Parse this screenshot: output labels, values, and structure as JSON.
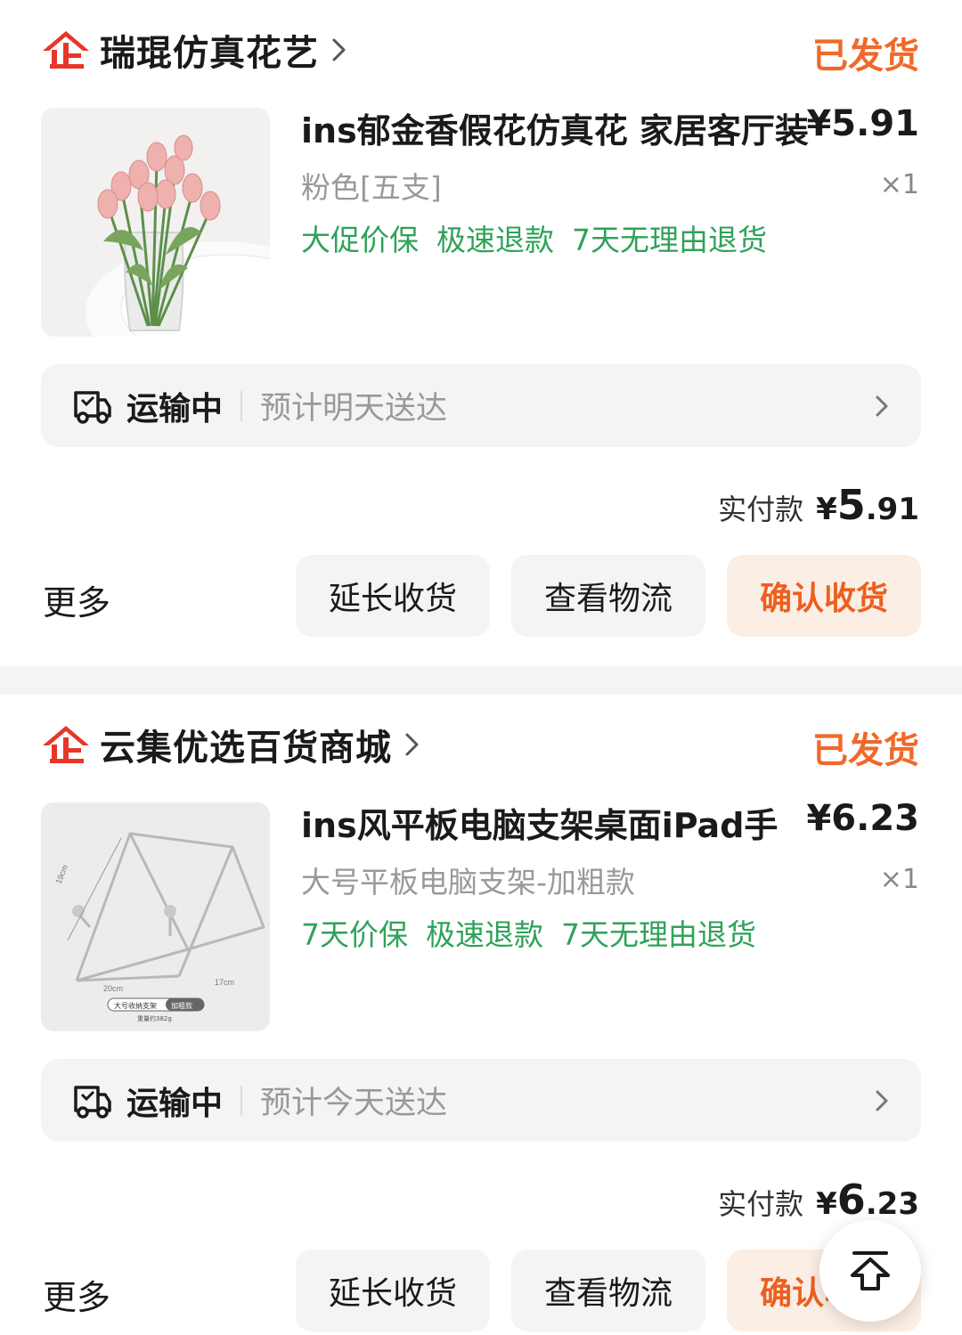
{
  "orders": [
    {
      "shop_name": "瑞琨仿真花艺",
      "status": "已发货",
      "product": {
        "title": "ins郁金香假花仿真花 家居客厅装",
        "price": "¥5.91",
        "spec": "粉色[五支]",
        "qty": "×1",
        "tags": [
          "大促价保",
          "极速退款",
          "7天无理由退货"
        ],
        "thumbnail": "pink-tulips-in-vase"
      },
      "shipping": {
        "state": "运输中",
        "eta": "预计明天送达"
      },
      "paid": {
        "label": "实付款",
        "symbol": "¥",
        "int": "5",
        "dec": ".91"
      },
      "more_label": "更多",
      "buttons": {
        "extend": "延长收货",
        "logistics": "查看物流",
        "confirm": "确认收货"
      }
    },
    {
      "shop_name": "云集优选百货商城",
      "status": "已发货",
      "product": {
        "title": "ins风平板电脑支架桌面iPad手",
        "price": "¥6.23",
        "spec": "大号平板电脑支架-加粗款",
        "qty": "×1",
        "tags": [
          "7天价保",
          "极速退款",
          "7天无理由退货"
        ],
        "thumbnail": "metal-tablet-stand",
        "thumbnail_text": {
          "dim1": "19cm",
          "dim2": "20cm",
          "dim3": "17cm",
          "badge": "大号收纳支架",
          "badge2": "加粗款",
          "weight": "重量约382g"
        }
      },
      "shipping": {
        "state": "运输中",
        "eta": "预计今天送达"
      },
      "paid": {
        "label": "实付款",
        "symbol": "¥",
        "int": "6",
        "dec": ".23"
      },
      "more_label": "更多",
      "buttons": {
        "extend": "延长收货",
        "logistics": "查看物流",
        "confirm": "确认收货"
      }
    }
  ],
  "colors": {
    "accent_orange": "#f0692a",
    "tag_green": "#2fa25a",
    "shop_icon_red": "#e8352a"
  },
  "icons": {
    "shop": "enterprise-shop-icon",
    "truck": "truck-icon",
    "chevron": "chevron-right-icon",
    "back_to_top": "back-to-top-icon"
  }
}
